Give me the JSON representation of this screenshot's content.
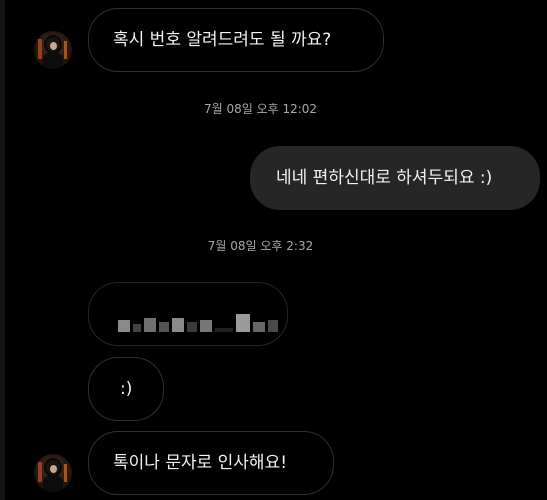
{
  "messages": {
    "m1": {
      "text": "혹시 번호 알려드려도 될 까요?"
    },
    "ts1": "7월 08일 오후 12:02",
    "m2": {
      "text": "네네 편하신대로 하셔두되요 :)"
    },
    "ts2": "7월 08일 오후 2:32",
    "m3": {
      "text": ""
    },
    "m4": {
      "text": ":)"
    },
    "m5": {
      "text": "톡이나 문자로 인사해요!"
    }
  },
  "colors": {
    "background": "#000000",
    "outgoing_bubble": "#262626",
    "incoming_border": "#2f2f2f",
    "timestamp": "#a8a8a8"
  }
}
